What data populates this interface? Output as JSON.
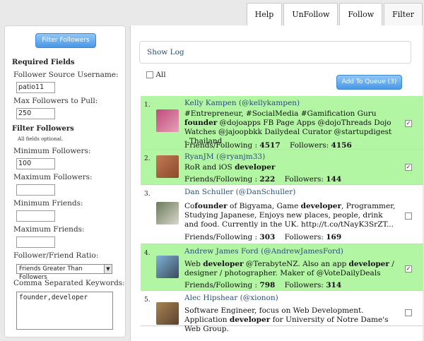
{
  "tabs": [
    {
      "label": "Help"
    },
    {
      "label": "UnFollow"
    },
    {
      "label": "Follow"
    },
    {
      "label": "Filter"
    }
  ],
  "sidebar": {
    "filter_button": "Filter Followers",
    "required_heading": "Required Fields",
    "source_label": "Follower Source Username:",
    "source_value": "patio11",
    "max_label": "Max Followers to Pull:",
    "max_value": "250",
    "filter_heading": "Filter Followers",
    "optional_note": "All fields optional.",
    "min_followers_label": "Minimum Followers:",
    "min_followers_value": "100",
    "max_followers_label": "Maximum Followers:",
    "max_followers_value": "",
    "min_friends_label": "Minimum Friends:",
    "min_friends_value": "",
    "max_friends_label": "Maximum Friends:",
    "max_friends_value": "",
    "ratio_label": "Follower/Friend Ratio:",
    "ratio_value": "Friends Greater Than Followers",
    "keywords_label": "Comma Separated Keywords:",
    "keywords_value": "founder,developer"
  },
  "main": {
    "show_log": "Show Log",
    "all_label": "All",
    "queue_button": "Add To Queue (3)",
    "friends_label": "Friends/Following :",
    "followers_label": "Followers:",
    "users": [
      {
        "num": "1.",
        "name": "Kelly Kampen (@kellykampen)",
        "bio_parts": [
          [
            "#Entrepreneur, #SocialMedia #Gamification Guru ",
            false
          ],
          [
            "founder",
            true
          ],
          [
            " @dojoapps FB Page Apps @dojoThreads Dojo Watches @jajoopbkk Dailydeal Curator @startupdigest - Thailand",
            false
          ]
        ],
        "friends": "4517",
        "followers": "4156",
        "selected": true
      },
      {
        "num": "2.",
        "name": "RyanJM (@ryanjm33)",
        "bio_parts": [
          [
            "RoR and iOS ",
            false
          ],
          [
            "developer",
            true
          ]
        ],
        "friends": "222",
        "followers": "144",
        "selected": true
      },
      {
        "num": "3.",
        "name": "Dan Schuller (@DanSchuller)",
        "bio_parts": [
          [
            "Co",
            false
          ],
          [
            "founder",
            true
          ],
          [
            " of Bigyama, Game ",
            false
          ],
          [
            "developer",
            true
          ],
          [
            ", Programmer, Studying Japanese, Enjoys new places, people, drink and food. Currently in the UK. http://t.co/tNayK3SrZT...",
            false
          ]
        ],
        "friends": "303",
        "followers": "169",
        "selected": false
      },
      {
        "num": "4.",
        "name": "Andrew James Ford (@AndrewJamesFord)",
        "bio_parts": [
          [
            "Web ",
            false
          ],
          [
            "developer",
            true
          ],
          [
            " @TerabyteNZ. Also an app ",
            false
          ],
          [
            "developer",
            true
          ],
          [
            " / designer / photographer. Maker of @VoteDailyDeals",
            false
          ]
        ],
        "friends": "798",
        "followers": "314",
        "selected": true
      },
      {
        "num": "5.",
        "name": "Alec Hipshear (@xionon)",
        "bio_parts": [
          [
            "Software Engineer, focus on Web Development. Application ",
            false
          ],
          [
            "developer",
            true
          ],
          [
            " for University of Notre Dame's Web Group.",
            false
          ]
        ],
        "friends": "",
        "followers": "",
        "selected": false
      }
    ]
  },
  "colors": {
    "highlight_row": "#b2f5a3",
    "link": "#2a4f7a",
    "button_blue": "#4a98e6"
  }
}
